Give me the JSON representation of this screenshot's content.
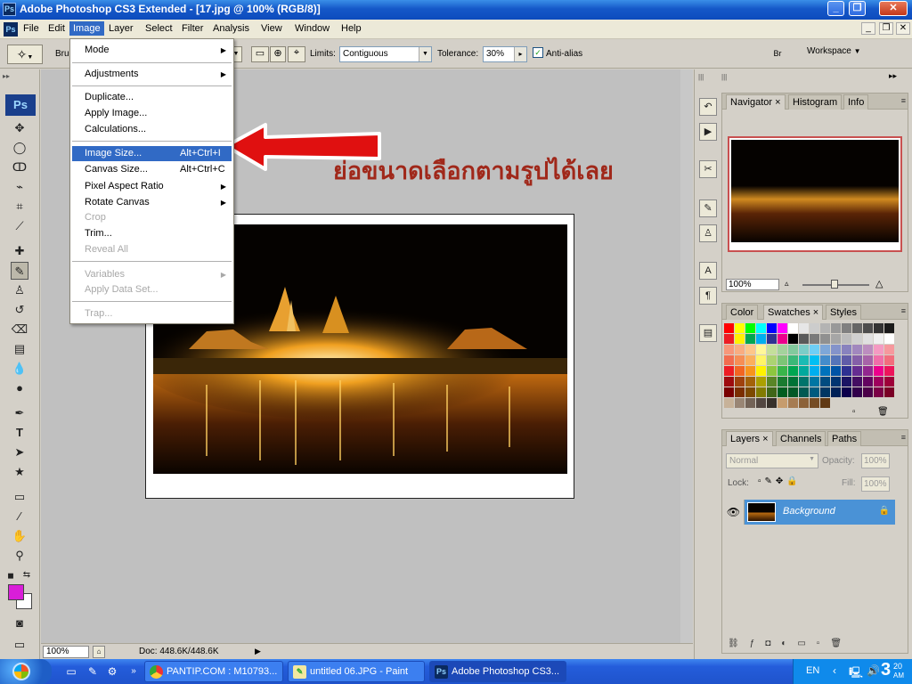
{
  "window": {
    "title": "Adobe Photoshop CS3 Extended - [17.jpg @ 100% (RGB/8)]",
    "app_icon": "Ps",
    "controls": {
      "minimize": "_",
      "restore": "❐",
      "close": "✕"
    }
  },
  "menubar": {
    "items": [
      "File",
      "Edit",
      "Image",
      "Layer",
      "Select",
      "Filter",
      "Analysis",
      "View",
      "Window",
      "Help"
    ],
    "active": "Image",
    "doc_controls": {
      "minimize": "_",
      "restore": "❐",
      "close": "✕"
    }
  },
  "options": {
    "brush_label_partial": "Bru",
    "limits_label": "Limits:",
    "limits_value": "Contiguous",
    "tolerance_label": "Tolerance:",
    "tolerance_value": "30%",
    "antialias_label": "Anti-alias",
    "antialias_checked": true,
    "workspace_label": "Workspace"
  },
  "image_menu": {
    "groups": [
      [
        {
          "label": "Mode",
          "submenu": true
        }
      ],
      [
        {
          "label": "Adjustments",
          "submenu": true
        }
      ],
      [
        {
          "label": "Duplicate..."
        },
        {
          "label": "Apply Image..."
        },
        {
          "label": "Calculations..."
        }
      ],
      [
        {
          "label": "Image Size...",
          "shortcut": "Alt+Ctrl+I",
          "highlighted": true
        },
        {
          "label": "Canvas Size...",
          "shortcut": "Alt+Ctrl+C"
        },
        {
          "label": "Pixel Aspect Ratio",
          "submenu": true
        },
        {
          "label": "Rotate Canvas",
          "submenu": true
        },
        {
          "label": "Crop",
          "disabled": true
        },
        {
          "label": "Trim..."
        },
        {
          "label": "Reveal All",
          "disabled": true
        }
      ],
      [
        {
          "label": "Variables",
          "submenu": true,
          "disabled": true
        },
        {
          "label": "Apply Data Set...",
          "disabled": true
        }
      ],
      [
        {
          "label": "Trap...",
          "disabled": true
        }
      ]
    ]
  },
  "annotation": {
    "text": "ย่อขนาดเลือกตามรูปได้เลย",
    "color": "#a0281a",
    "arrow_color": "#e01010"
  },
  "status": {
    "zoom": "100%",
    "doc": "Doc: 448.6K/448.6K"
  },
  "navigator": {
    "tabs": [
      "Navigator",
      "Histogram",
      "Info"
    ],
    "zoom": "100%"
  },
  "swatch_panel": {
    "tabs": [
      "Color",
      "Swatches",
      "Styles"
    ]
  },
  "layers_panel": {
    "tabs": [
      "Layers",
      "Channels",
      "Paths"
    ],
    "blend_mode": "Normal",
    "opacity_label": "Opacity:",
    "opacity": "100%",
    "lock_label": "Lock:",
    "fill_label": "Fill:",
    "fill": "100%",
    "layers": [
      {
        "name": "Background",
        "visible": true,
        "locked": true
      }
    ]
  },
  "toolbox": {
    "logo": "Ps",
    "foreground_color": "#d91ed8",
    "background_color": "#ffffff"
  },
  "taskbar": {
    "tasks": [
      {
        "label": "PANTIP.COM : M10793...",
        "icon": "chrome-icon"
      },
      {
        "label": "untitled 06.JPG - Paint",
        "icon": "paint-icon"
      },
      {
        "label": "Adobe Photoshop CS3...",
        "icon": "photoshop-icon",
        "active": true
      }
    ],
    "language": "EN",
    "clock": "3",
    "clock_minutes": "20",
    "clock_ampm": "AM"
  }
}
